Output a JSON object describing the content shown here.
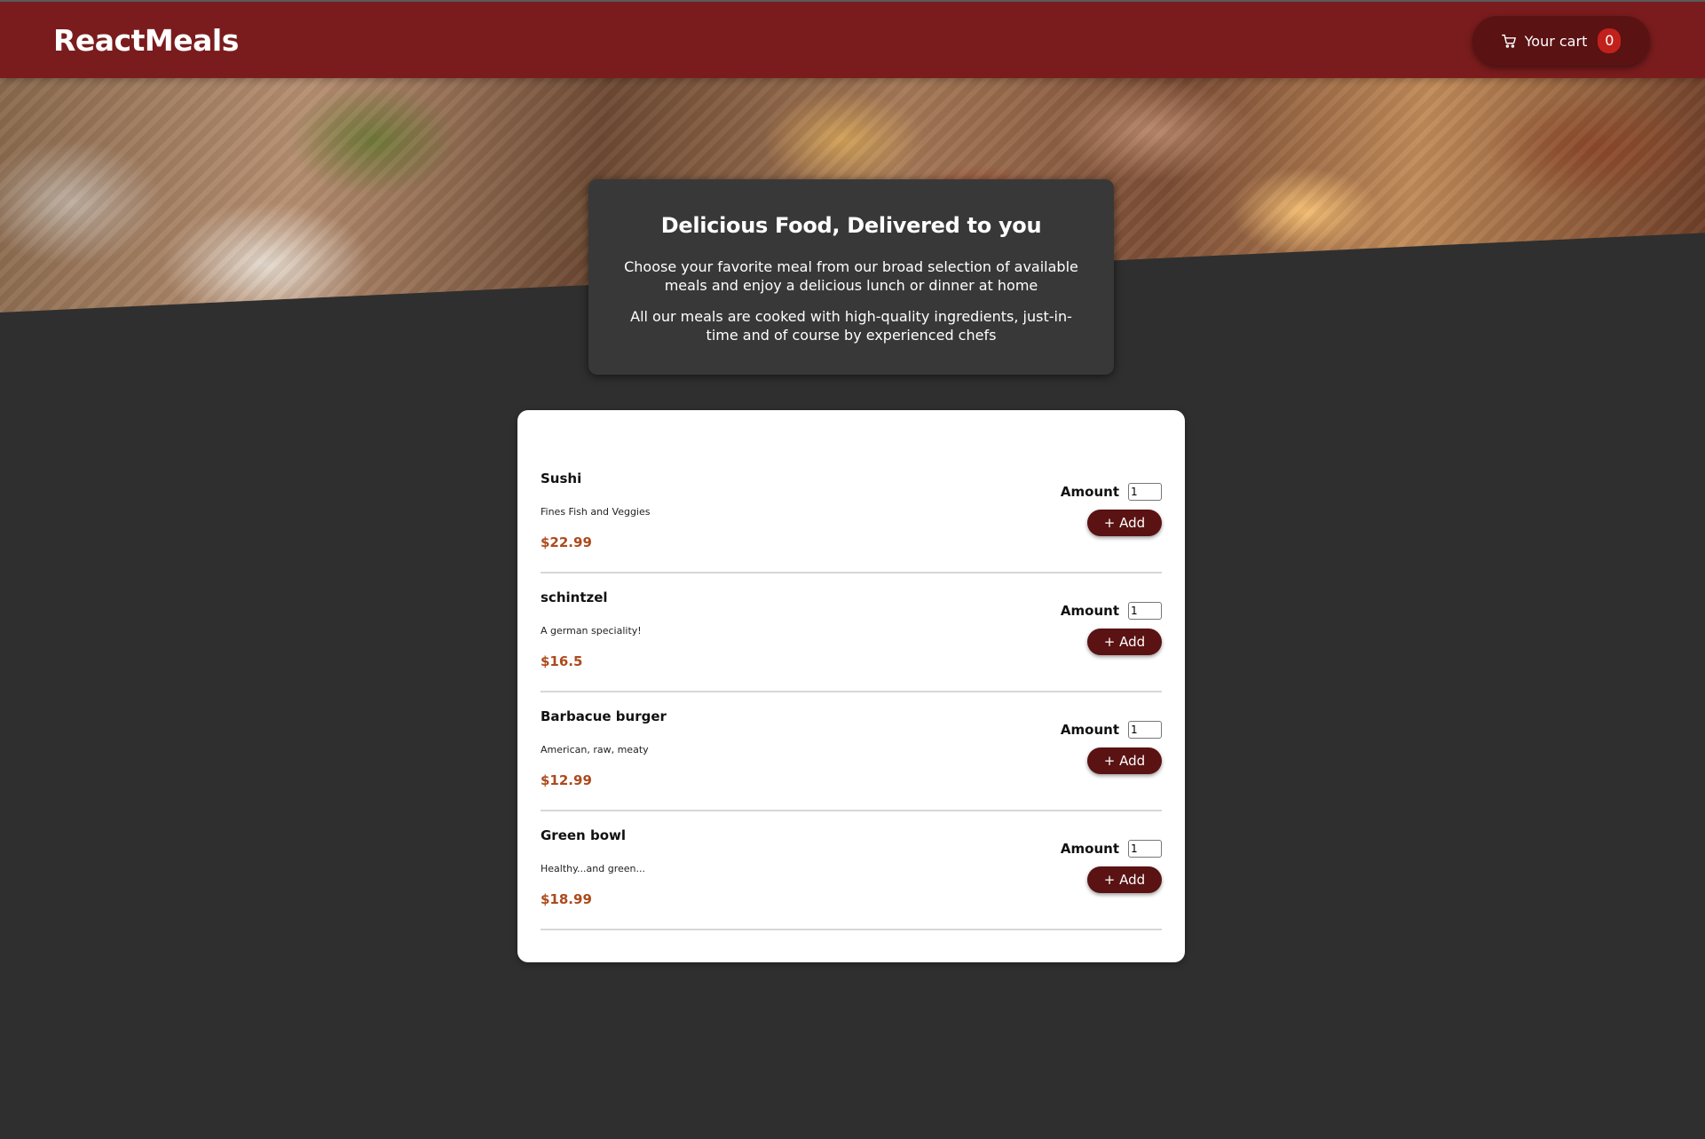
{
  "header": {
    "brand": "ReactMeals",
    "cart_label": "Your cart",
    "cart_count": "0",
    "cart_icon": "cart-icon"
  },
  "summary": {
    "title": "Delicious Food, Delivered to you",
    "paragraph_1": "Choose your favorite meal from our broad selection of available meals and enjoy a delicious lunch or dinner at home",
    "paragraph_2": "All our meals are cooked with high-quality ingredients, just-in-time and of course by experienced chefs"
  },
  "meals": [
    {
      "name": "Sushi",
      "description": "Fines Fish and Veggies",
      "price": "$22.99",
      "amount_label": "Amount",
      "amount_value": "1",
      "add_label": "+ Add"
    },
    {
      "name": "schintzel",
      "description": "A german speciality!",
      "price": "$16.5",
      "amount_label": "Amount",
      "amount_value": "1",
      "add_label": "+ Add"
    },
    {
      "name": "Barbacue burger",
      "description": "American, raw, meaty",
      "price": "$12.99",
      "amount_label": "Amount",
      "amount_value": "1",
      "add_label": "+ Add"
    },
    {
      "name": "Green bowl",
      "description": "Healthy...and green...",
      "price": "$18.99",
      "amount_label": "Amount",
      "amount_value": "1",
      "add_label": "+ Add"
    }
  ],
  "colors": {
    "header_bg": "#7a1c1d",
    "button_bg": "#5a1213",
    "badge_bg": "#c2211b",
    "price": "#ad4a1c",
    "page_bg": "#2f2f2f",
    "summary_bg": "#383838"
  }
}
